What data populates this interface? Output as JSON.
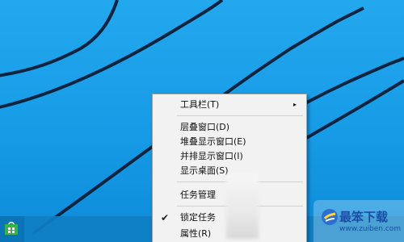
{
  "colors": {
    "desktop_blue": "#1e9ae0",
    "taskbar": "#0f7fc4",
    "menu_bg": "#f2f2f2",
    "menu_text": "#111111",
    "watermark_text": "#1a4ea6"
  },
  "taskbar": {
    "start_icon": "store-icon"
  },
  "context_menu": {
    "items": [
      {
        "label": "工具栏(T)",
        "has_submenu": true
      },
      {
        "label": "层叠窗口(D)"
      },
      {
        "label": "堆叠显示窗口(E)"
      },
      {
        "label": "并排显示窗口(I)"
      },
      {
        "label": "显示桌面(S)"
      },
      {
        "label": "任务管理"
      },
      {
        "label": "锁定任务",
        "checked": true
      },
      {
        "label": "属性(R)"
      }
    ],
    "submenu_arrow": "▸",
    "check_glyph": "✔"
  },
  "watermark": {
    "title": "最笨下载",
    "url": "www.zuiben.com"
  }
}
